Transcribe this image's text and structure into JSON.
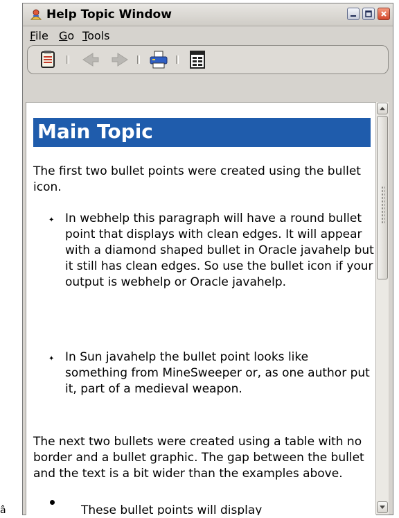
{
  "window": {
    "title": "Help Topic Window"
  },
  "titlebar_buttons": [
    {
      "icon": "minimize-icon"
    },
    {
      "icon": "maximize-icon"
    },
    {
      "icon": "close-icon"
    }
  ],
  "menu": {
    "file": {
      "hotkey": "F",
      "rest": "ile"
    },
    "go": {
      "hotkey": "G",
      "rest": "o"
    },
    "tools": {
      "hotkey": "T",
      "rest": "ools"
    }
  },
  "toolbar": {
    "buttons": [
      {
        "icon": "contents-icon"
      },
      {
        "icon": "back-arrow-icon",
        "enabled": false
      },
      {
        "icon": "forward-arrow-icon",
        "enabled": false
      },
      {
        "icon": "printer-icon"
      },
      {
        "icon": "page-setup-icon"
      }
    ]
  },
  "content": {
    "heading": "Main Topic",
    "paragraphs": [
      "The first two bullet points were created using the bullet icon.",
      "The next two bullets were created using a table with no border and a bullet graphic. The gap between the bullet and the text is a bit wider than the examples above."
    ],
    "bullets": [
      "In webhelp this paragraph will have a round bullet point that displays with clean edges. It will appear with a diamond shaped bullet in Oracle javahelp but it still has clean edges. So use the bullet icon if your output is webhelp or Oracle javahelp.",
      "In Sun javahelp the bullet point looks like something from MineSweeper or, as one author put it, part of a medieval weapon."
    ],
    "table_bullets": [
      "These bullet points will display"
    ],
    "bullet_glyph": "✦"
  },
  "colors": {
    "heading_background": "#1f5cac",
    "heading_text": "#ffffff",
    "window_background": "#d6d3ce"
  },
  "corner_glyph": "â"
}
